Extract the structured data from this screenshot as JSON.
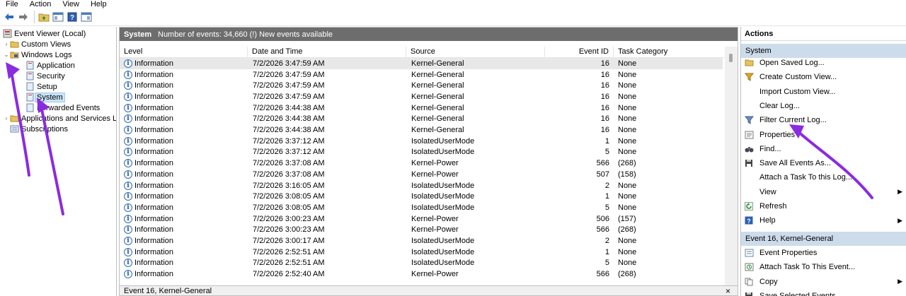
{
  "menu": [
    "File",
    "Action",
    "View",
    "Help"
  ],
  "toolbar_icons": [
    "back-arrow-icon",
    "forward-arrow-icon",
    "folder-up-icon",
    "show-hide-tree-icon",
    "help-icon",
    "properties-icon"
  ],
  "tree": {
    "root": "Event Viewer (Local)",
    "custom_views": "Custom Views",
    "windows_logs": "Windows Logs",
    "application": "Application",
    "security": "Security",
    "setup": "Setup",
    "system": "System",
    "forwarded": "Forwarded Events",
    "apps_services": "Applications and Services Log",
    "subscriptions": "Subscriptions"
  },
  "center": {
    "title": "System",
    "summary": "Number of events: 34,660 (!) New events available",
    "columns": [
      "Level",
      "Date and Time",
      "Source",
      "Event ID",
      "Task Category"
    ],
    "rows": [
      {
        "level": "Information",
        "date": "7/2/2026 3:47:59 AM",
        "source": "Kernel-General",
        "id": "16",
        "cat": "None"
      },
      {
        "level": "Information",
        "date": "7/2/2026 3:47:59 AM",
        "source": "Kernel-General",
        "id": "16",
        "cat": "None"
      },
      {
        "level": "Information",
        "date": "7/2/2026 3:47:59 AM",
        "source": "Kernel-General",
        "id": "16",
        "cat": "None"
      },
      {
        "level": "Information",
        "date": "7/2/2026 3:47:59 AM",
        "source": "Kernel-General",
        "id": "16",
        "cat": "None"
      },
      {
        "level": "Information",
        "date": "7/2/2026 3:44:38 AM",
        "source": "Kernel-General",
        "id": "16",
        "cat": "None"
      },
      {
        "level": "Information",
        "date": "7/2/2026 3:44:38 AM",
        "source": "Kernel-General",
        "id": "16",
        "cat": "None"
      },
      {
        "level": "Information",
        "date": "7/2/2026 3:44:38 AM",
        "source": "Kernel-General",
        "id": "16",
        "cat": "None"
      },
      {
        "level": "Information",
        "date": "7/2/2026 3:37:12 AM",
        "source": "IsolatedUserMode",
        "id": "1",
        "cat": "None"
      },
      {
        "level": "Information",
        "date": "7/2/2026 3:37:12 AM",
        "source": "IsolatedUserMode",
        "id": "5",
        "cat": "None"
      },
      {
        "level": "Information",
        "date": "7/2/2026 3:37:08 AM",
        "source": "Kernel-Power",
        "id": "566",
        "cat": "(268)"
      },
      {
        "level": "Information",
        "date": "7/2/2026 3:37:08 AM",
        "source": "Kernel-Power",
        "id": "507",
        "cat": "(158)"
      },
      {
        "level": "Information",
        "date": "7/2/2026 3:16:05 AM",
        "source": "IsolatedUserMode",
        "id": "2",
        "cat": "None"
      },
      {
        "level": "Information",
        "date": "7/2/2026 3:08:05 AM",
        "source": "IsolatedUserMode",
        "id": "1",
        "cat": "None"
      },
      {
        "level": "Information",
        "date": "7/2/2026 3:08:05 AM",
        "source": "IsolatedUserMode",
        "id": "5",
        "cat": "None"
      },
      {
        "level": "Information",
        "date": "7/2/2026 3:00:23 AM",
        "source": "Kernel-Power",
        "id": "506",
        "cat": "(157)"
      },
      {
        "level": "Information",
        "date": "7/2/2026 3:00:23 AM",
        "source": "Kernel-Power",
        "id": "566",
        "cat": "(268)"
      },
      {
        "level": "Information",
        "date": "7/2/2026 3:00:17 AM",
        "source": "IsolatedUserMode",
        "id": "2",
        "cat": "None"
      },
      {
        "level": "Information",
        "date": "7/2/2026 2:52:51 AM",
        "source": "IsolatedUserMode",
        "id": "1",
        "cat": "None"
      },
      {
        "level": "Information",
        "date": "7/2/2026 2:52:51 AM",
        "source": "IsolatedUserMode",
        "id": "5",
        "cat": "None"
      },
      {
        "level": "Information",
        "date": "7/2/2026 2:52:40 AM",
        "source": "Kernel-Power",
        "id": "566",
        "cat": "(268)"
      }
    ],
    "detail_title": "Event 16, Kernel-General",
    "detail_close": "×"
  },
  "actions": {
    "title": "Actions",
    "section1": "System",
    "items1": [
      {
        "label": "Open Saved Log...",
        "icon": "folder-open-icon",
        "name": "open-saved-log"
      },
      {
        "label": "Create Custom View...",
        "icon": "filter-create-icon",
        "name": "create-custom-view"
      },
      {
        "label": "Import Custom View...",
        "icon": "",
        "name": "import-custom-view"
      },
      {
        "label": "Clear Log...",
        "icon": "",
        "name": "clear-log"
      },
      {
        "label": "Filter Current Log...",
        "icon": "filter-icon",
        "name": "filter-current-log"
      },
      {
        "label": "Properties",
        "icon": "properties-icon",
        "name": "properties"
      },
      {
        "label": "Find...",
        "icon": "binoculars-icon",
        "name": "find"
      },
      {
        "label": "Save All Events As...",
        "icon": "save-icon",
        "name": "save-all-events"
      },
      {
        "label": "Attach a Task To this Log...",
        "icon": "",
        "name": "attach-task-log"
      },
      {
        "label": "View",
        "icon": "",
        "name": "view",
        "submenu": true
      },
      {
        "label": "Refresh",
        "icon": "refresh-icon",
        "name": "refresh"
      },
      {
        "label": "Help",
        "icon": "help-icon",
        "name": "help",
        "submenu": true
      }
    ],
    "section2": "Event 16, Kernel-General",
    "items2": [
      {
        "label": "Event Properties",
        "icon": "event-properties-icon",
        "name": "event-properties"
      },
      {
        "label": "Attach Task To This Event...",
        "icon": "attach-task-icon",
        "name": "attach-task-event"
      },
      {
        "label": "Copy",
        "icon": "copy-icon",
        "name": "copy",
        "submenu": true
      },
      {
        "label": "Save Selected Events...",
        "icon": "save-icon",
        "name": "save-selected-events"
      }
    ]
  },
  "annotation_color": "#8a2be2"
}
